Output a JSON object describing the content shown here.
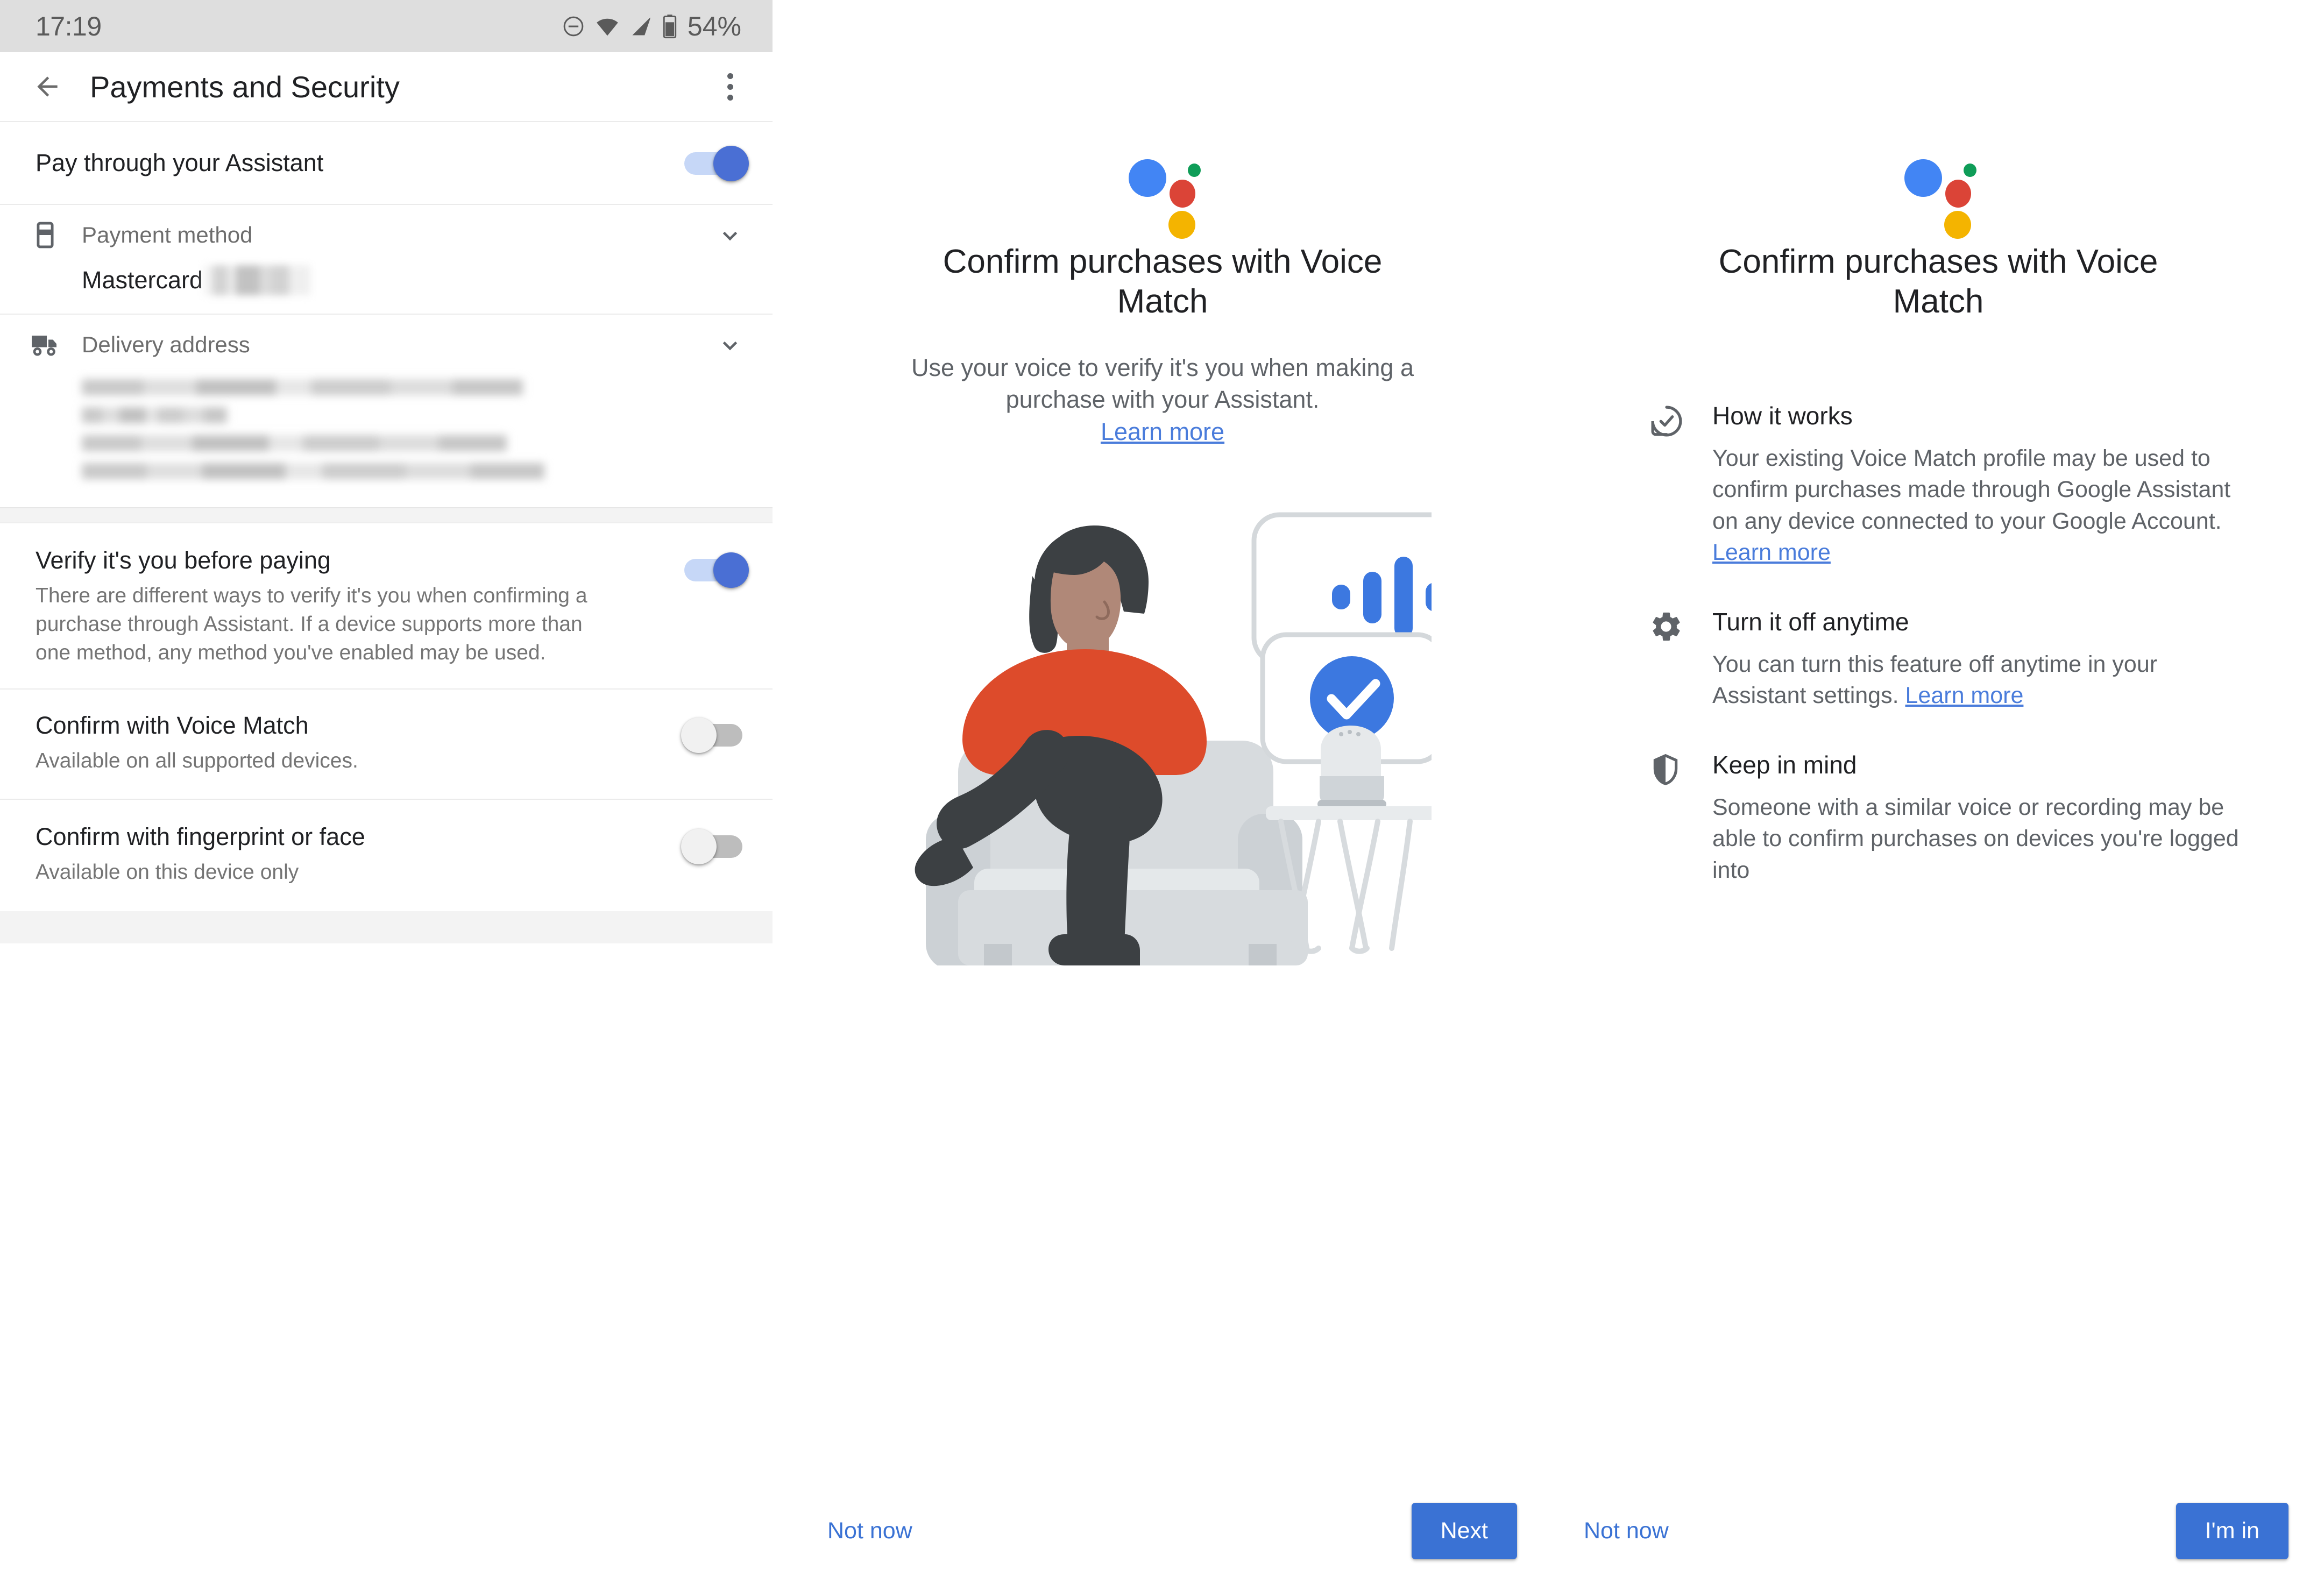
{
  "statusbar": {
    "time": "17:19",
    "battery_percent": "54%",
    "icons": [
      "do-not-disturb-icon",
      "wifi-icon",
      "cellular-signal-icon",
      "battery-icon"
    ]
  },
  "appbar": {
    "title": "Payments and Security",
    "back_label": "Back",
    "menu_label": "More options"
  },
  "settings": {
    "pay_through_assistant": {
      "title": "Pay through your Assistant",
      "toggle": "on"
    },
    "payment_method": {
      "label": "Payment method",
      "value": "Mastercard",
      "value_redacted": true
    },
    "delivery_address": {
      "label": "Delivery address",
      "value_redacted": true
    },
    "verify_before_paying": {
      "title": "Verify it's you before paying",
      "subtitle": "There are different ways to verify it's you when confirming a purchase through Assistant. If a device supports more than one method, any method you've enabled may be used.",
      "toggle": "on"
    },
    "confirm_voice_match": {
      "title": "Confirm with Voice Match",
      "subtitle": "Available on all supported devices.",
      "toggle": "off"
    },
    "confirm_fingerprint_face": {
      "title": "Confirm with fingerprint or face",
      "subtitle": "Available on this device only",
      "toggle": "off"
    }
  },
  "onboarding_intro": {
    "logo": "google-assistant-logo",
    "title": "Confirm purchases with Voice Match",
    "subtitle": "Use your voice to verify it's you when making a purchase with your Assistant.",
    "learn_more": "Learn more",
    "illustration": "person-in-armchair-talking-to-smart-speaker",
    "actions": {
      "secondary": "Not now",
      "primary": "Next"
    }
  },
  "onboarding_details": {
    "logo": "google-assistant-logo",
    "title": "Confirm purchases with Voice Match",
    "sections": [
      {
        "icon": "check-circle-icon",
        "title": "How it works",
        "text": "Your existing Voice Match profile may be used to confirm purchases made through Google Assistant on any device connected to your Google Account. ",
        "link": "Learn more"
      },
      {
        "icon": "gear-icon",
        "title": "Turn it off anytime",
        "text": "You can turn this feature off anytime in your Assistant settings. ",
        "link": "Learn more"
      },
      {
        "icon": "shield-icon",
        "title": "Keep in mind",
        "text": "Someone with a similar voice or recording may be able to confirm purchases on devices you're logged into",
        "link": ""
      }
    ],
    "actions": {
      "secondary": "Not now",
      "primary": "I'm in"
    }
  },
  "colors": {
    "accent_blue": "#3a72d4",
    "link_blue": "#4a7cdb",
    "assistant_blue": "#4285f4",
    "assistant_red": "#db4437",
    "assistant_yellow": "#f4b400",
    "assistant_green": "#0f9d58",
    "statusbar_bg": "#dedede",
    "footer_bg": "#f3f3f3",
    "text_primary": "#202124",
    "text_secondary": "#5f6368"
  }
}
